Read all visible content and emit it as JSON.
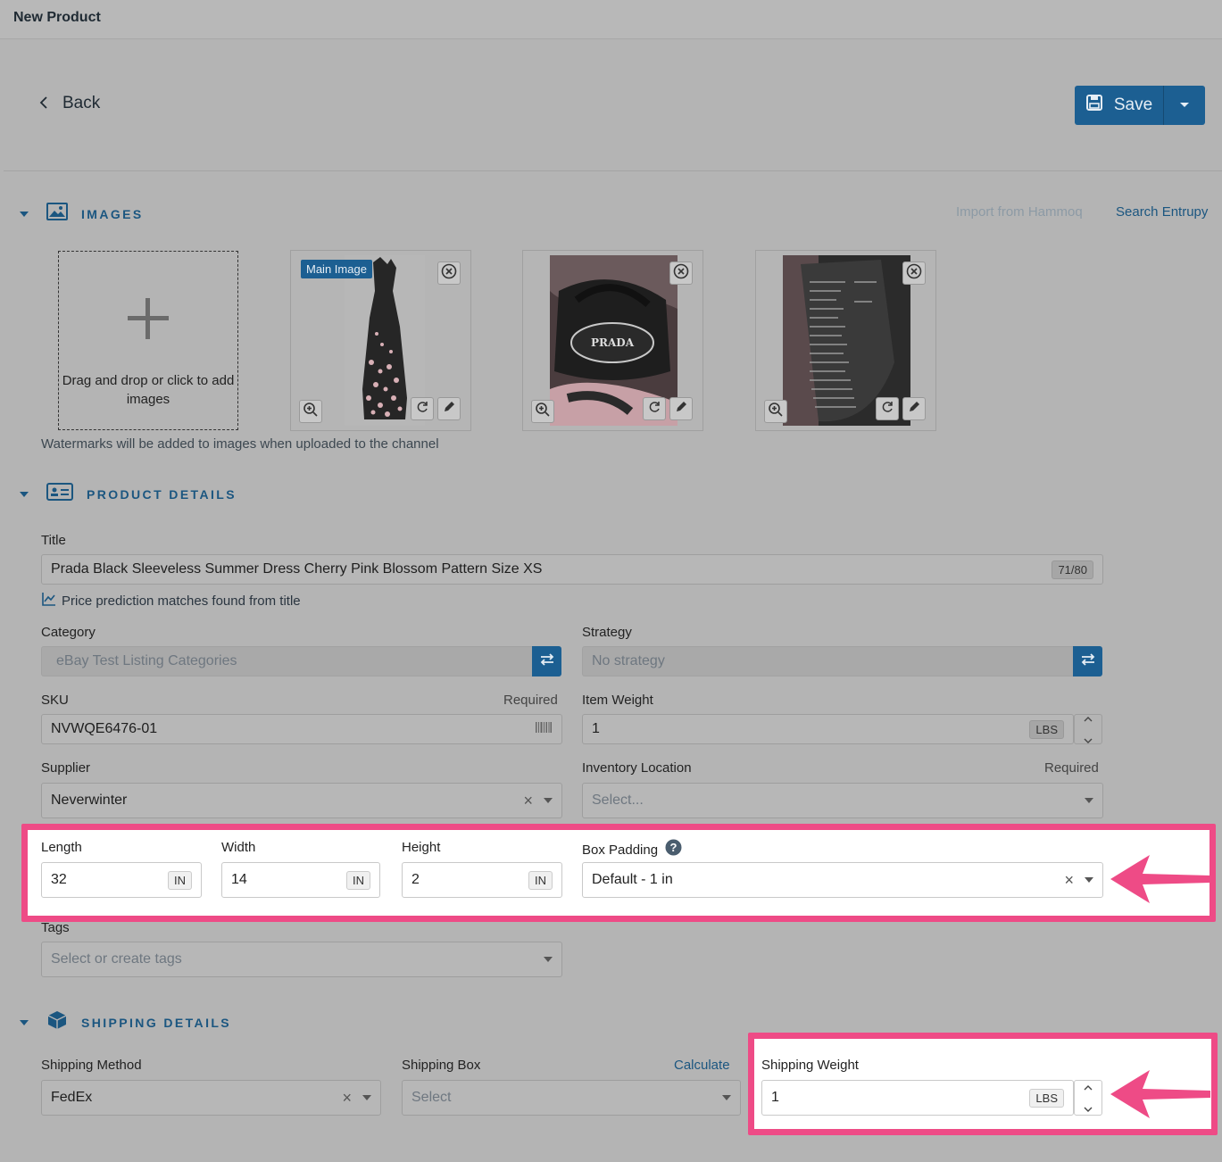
{
  "header": {
    "title": "New Product"
  },
  "nav": {
    "back_label": "Back"
  },
  "toolbar": {
    "save_label": "Save"
  },
  "images_section": {
    "title": "IMAGES",
    "import_link": "Import from Hammoq",
    "search_link": "Search Entrupy",
    "dropzone_text": "Drag and drop or click to add images",
    "main_badge": "Main Image",
    "watermark_note": "Watermarks will be added to images when uploaded to the channel",
    "photo_text": "PRADA"
  },
  "details_section": {
    "title": "PRODUCT DETAILS",
    "title_label": "Title",
    "title_value": "Prada Black Sleeveless Summer Dress Cherry Pink Blossom Pattern Size XS",
    "title_count": "71/80",
    "price_prediction": "Price prediction matches found from title",
    "category_label": "Category",
    "category_value": "eBay Test Listing Categories",
    "strategy_label": "Strategy",
    "strategy_value": "No strategy",
    "sku_label": "SKU",
    "sku_required": "Required",
    "sku_value": "NVWQE6476-01",
    "item_weight_label": "Item Weight",
    "item_weight_value": "1",
    "item_weight_unit": "LBS",
    "supplier_label": "Supplier",
    "supplier_value": "Neverwinter",
    "inventory_label": "Inventory Location",
    "inventory_required": "Required",
    "inventory_placeholder": "Select...",
    "length_label": "Length",
    "length_value": "32",
    "width_label": "Width",
    "width_value": "14",
    "height_label": "Height",
    "height_value": "2",
    "dim_unit": "IN",
    "box_padding_label": "Box Padding",
    "box_padding_value": "Default - 1 in",
    "tags_label": "Tags",
    "tags_placeholder": "Select or create tags"
  },
  "shipping_section": {
    "title": "SHIPPING DETAILS",
    "method_label": "Shipping Method",
    "method_value": "FedEx",
    "box_label": "Shipping Box",
    "calculate_link": "Calculate",
    "box_placeholder": "Select",
    "weight_label": "Shipping Weight",
    "weight_value": "1",
    "weight_unit": "LBS"
  },
  "colors": {
    "accent": "#1c5f92",
    "highlight": "#ee4b86",
    "overlay": "#b4b4b4"
  }
}
